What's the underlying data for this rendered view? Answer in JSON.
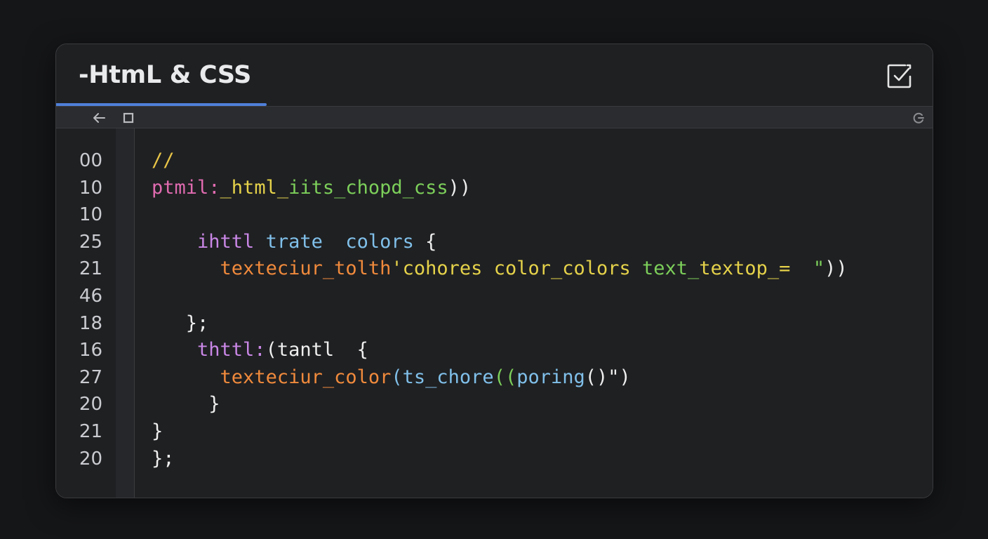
{
  "window": {
    "tab_title": "-HtmL & CSS"
  },
  "icons": {
    "check": "check-square-icon",
    "back": "arrow-left-icon",
    "square": "square-icon",
    "refresh": "refresh-icon"
  },
  "colors": {
    "background": "#151618",
    "panel": "#1f2022",
    "toolbar": "#2b2c2f",
    "accent": "#4f7fd9",
    "comment": "#e8c547",
    "pink": "#e06bb0",
    "purple": "#c987e6",
    "blue": "#80c0ea",
    "orange": "#f08a3c",
    "green": "#7ccf5a",
    "yellow": "#e5d24a",
    "white": "#eeeeee"
  },
  "line_numbers": [
    "00",
    "10",
    "10",
    "25",
    "21",
    "46",
    "18",
    "16",
    "27",
    "20",
    "21",
    "20"
  ],
  "code": [
    [
      {
        "t": "//",
        "c": "comment"
      }
    ],
    [
      {
        "t": "ptmil:",
        "c": "pink"
      },
      {
        "t": "_html_",
        "c": "yellow"
      },
      {
        "t": "iits_chopd_css",
        "c": "green"
      },
      {
        "t": "))",
        "c": "white"
      }
    ],
    [],
    [
      {
        "t": "    ",
        "c": "white"
      },
      {
        "t": "ihttl",
        "c": "purple"
      },
      {
        "t": " trate  colors",
        "c": "blue"
      },
      {
        "t": " {",
        "c": "white"
      }
    ],
    [
      {
        "t": "      ",
        "c": "white"
      },
      {
        "t": "texteciur_tolth",
        "c": "orange"
      },
      {
        "t": "'cohores color_colors",
        "c": "yellow"
      },
      {
        "t": " text_",
        "c": "green"
      },
      {
        "t": "textop_=",
        "c": "yellow"
      },
      {
        "t": "  \"",
        "c": "green"
      },
      {
        "t": "))",
        "c": "white"
      }
    ],
    [],
    [
      {
        "t": "   };",
        "c": "white"
      }
    ],
    [
      {
        "t": "    ",
        "c": "white"
      },
      {
        "t": "thttl:",
        "c": "purple"
      },
      {
        "t": "(tantl  {",
        "c": "white"
      }
    ],
    [
      {
        "t": "      ",
        "c": "white"
      },
      {
        "t": "texteciur_color",
        "c": "orange"
      },
      {
        "t": "(ts_chore",
        "c": "blue"
      },
      {
        "t": "((",
        "c": "green"
      },
      {
        "t": "poring",
        "c": "blue"
      },
      {
        "t": "()\")",
        "c": "white"
      }
    ],
    [
      {
        "t": "     }",
        "c": "white"
      }
    ],
    [
      {
        "t": "}",
        "c": "white"
      }
    ],
    [
      {
        "t": "};",
        "c": "white"
      }
    ]
  ]
}
